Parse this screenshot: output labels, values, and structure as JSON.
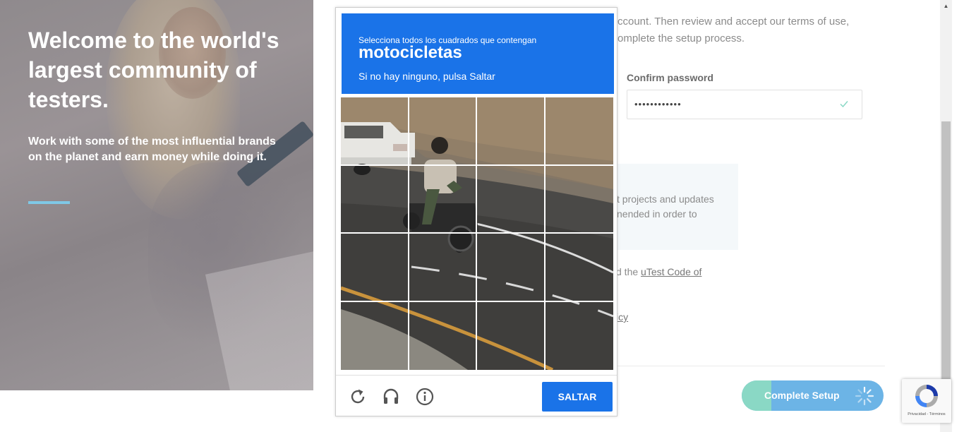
{
  "hero": {
    "title": "Welcome to the world's largest community of testers.",
    "subtitle": "Work with some of the most influential brands on the planet and earn money while doing it."
  },
  "form": {
    "intro": "ccount. Then review and accept our terms of use, omplete the setup process.",
    "confirm_password_label": "Confirm password",
    "confirm_password_value": "••••••••••••",
    "info_text": "t projects and updates nended in order to",
    "code_prefix": "d the ",
    "code_link": "uTest Code of",
    "policy_text": "icy",
    "complete_button": "Complete Setup"
  },
  "captcha": {
    "instruction": "Selecciona todos los cuadrados que contengan",
    "target": "motocicletas",
    "hint": "Si no hay ninguno, pulsa Saltar",
    "skip_button": "SALTAR",
    "icons": [
      "reload-icon",
      "audio-icon",
      "info-icon"
    ]
  },
  "recaptcha_badge": {
    "links": "Privacidad - Términos"
  },
  "colors": {
    "captcha_blue": "#1a73e8",
    "button_blue": "#6cb4e6",
    "button_green": "#8ad8c5",
    "accent_line": "#7fc8e6"
  }
}
